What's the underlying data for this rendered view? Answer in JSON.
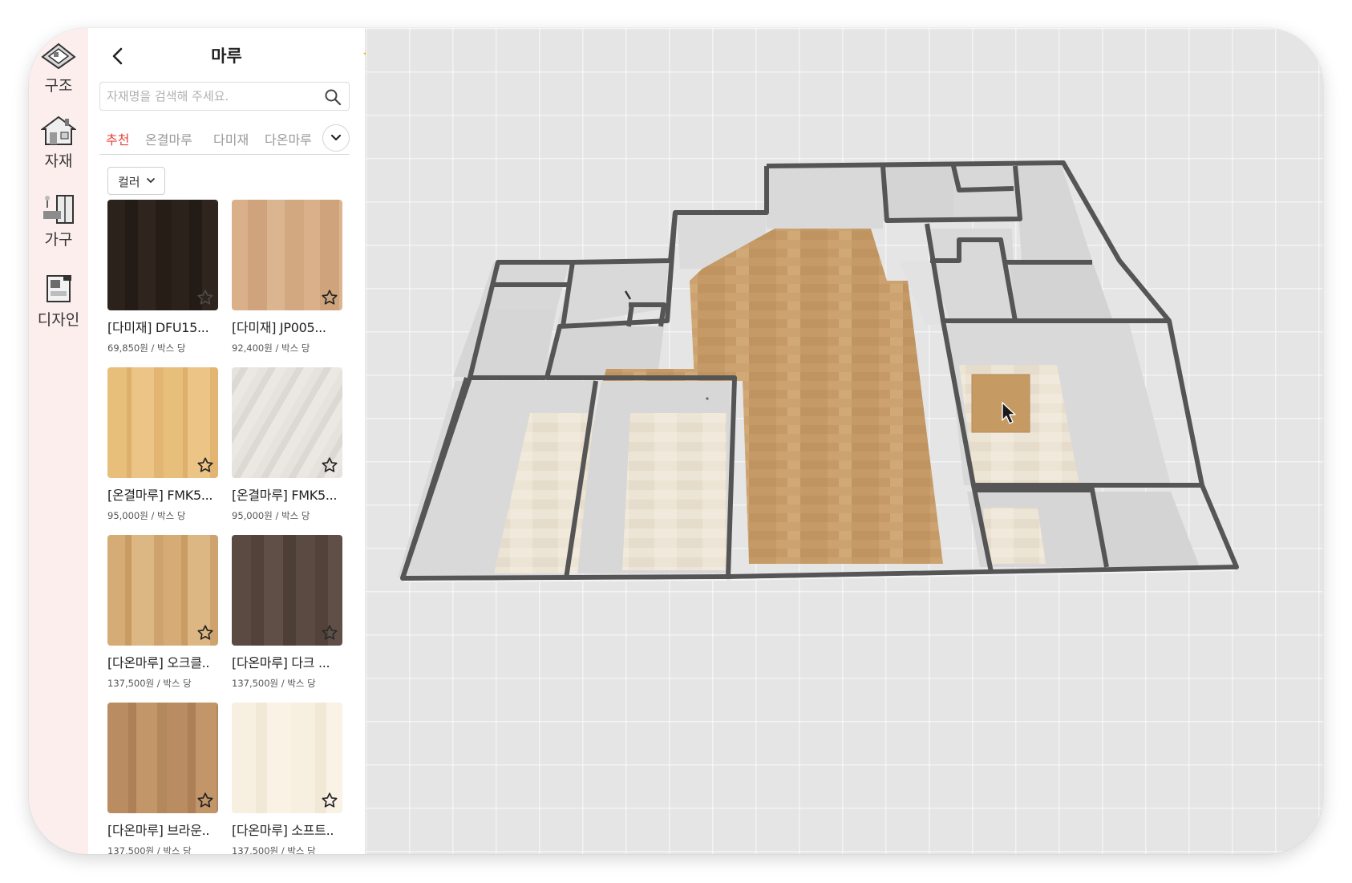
{
  "rail": {
    "items": [
      {
        "label": "구조",
        "icon": "house-structure-icon"
      },
      {
        "label": "자재",
        "icon": "house-material-icon"
      },
      {
        "label": "가구",
        "icon": "furniture-icon"
      },
      {
        "label": "디자인",
        "icon": "design-icon"
      }
    ]
  },
  "panel": {
    "title": "마루",
    "favorite_color": "#f5b400",
    "search": {
      "placeholder": "자재명을 검색해 주세요.",
      "value": ""
    },
    "tabs": [
      {
        "label": "추천",
        "active": true
      },
      {
        "label": "온결마루",
        "active": false
      },
      {
        "label": "다미재",
        "active": false
      },
      {
        "label": "다온마루",
        "active": false
      }
    ],
    "filter_label": "컬러",
    "accent_color": "#e8443b",
    "products": [
      {
        "name": "[다미재] DFU15...",
        "price": "69,850원 / 박스 당"
      },
      {
        "name": "[다미재] JP005...",
        "price": "92,400원 / 박스 당"
      },
      {
        "name": "[온결마루] FMK5...",
        "price": "95,000원 / 박스 당"
      },
      {
        "name": "[온결마루] FMK5...",
        "price": "95,000원 / 박스 당"
      },
      {
        "name": "[다온마루] 오크클..",
        "price": "137,500원 / 박스 당"
      },
      {
        "name": "[다온마루] 다크 ...",
        "price": "137,500원 / 박스 당"
      },
      {
        "name": "[다온마루] 브라운..",
        "price": "137,500원 / 박스 당"
      },
      {
        "name": "[다온마루] 소프트..",
        "price": "137,500원 / 박스 당"
      }
    ]
  },
  "viewport": {
    "floor_selected_color": "#c69a63",
    "wall_color": "#555555"
  }
}
